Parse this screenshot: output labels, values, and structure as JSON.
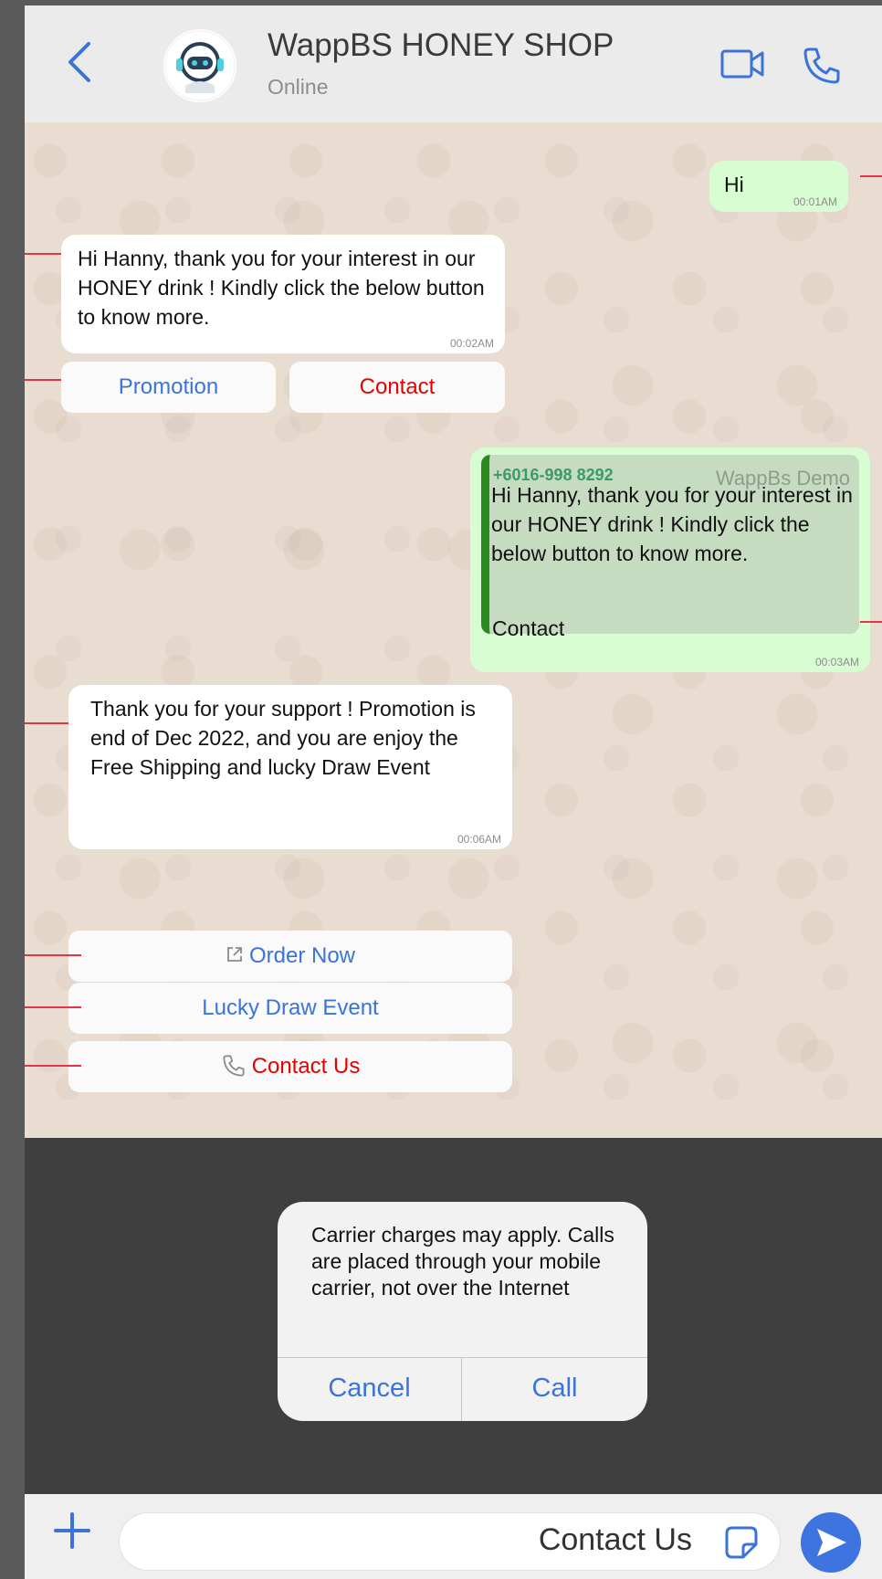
{
  "header": {
    "title": "WappBS HONEY SHOP",
    "status": "Online"
  },
  "messages": {
    "m1": {
      "text": "Hi",
      "time": "00:01AM"
    },
    "m2": {
      "text": "Hi Hanny, thank you for your interest in our HONEY drink ! Kindly click the below button to know more.",
      "time": "00:02AM"
    },
    "m2_buttons": {
      "promotion": "Promotion",
      "contact": "Contact"
    },
    "m3": {
      "quote_phone": "+6016-998 8292",
      "quote_source": "WappBs Demo",
      "quote_text": "Hi Hanny, thank you for your interest in our HONEY drink ! Kindly click the below button to know more.",
      "text": "Contact",
      "time": "00:03AM"
    },
    "m4": {
      "text": "Thank you for your support ! Promotion is end of Dec 2022, and you are enjoy the Free Shipping and lucky Draw Event",
      "time": "00:06AM"
    },
    "m4_buttons": {
      "order_now": "Order Now",
      "lucky_draw": "Lucky Draw Event",
      "contact_us": "Contact Us"
    }
  },
  "dialog": {
    "text": "Carrier charges may apply. Calls are placed through your mobile carrier, not over the Internet",
    "cancel": "Cancel",
    "call": "Call"
  },
  "input": {
    "value": "Contact Us"
  },
  "colors": {
    "accent": "#3b73d9",
    "danger": "#e80000",
    "outgoing": "#d9fdd3",
    "annotation": "#e3354a"
  }
}
